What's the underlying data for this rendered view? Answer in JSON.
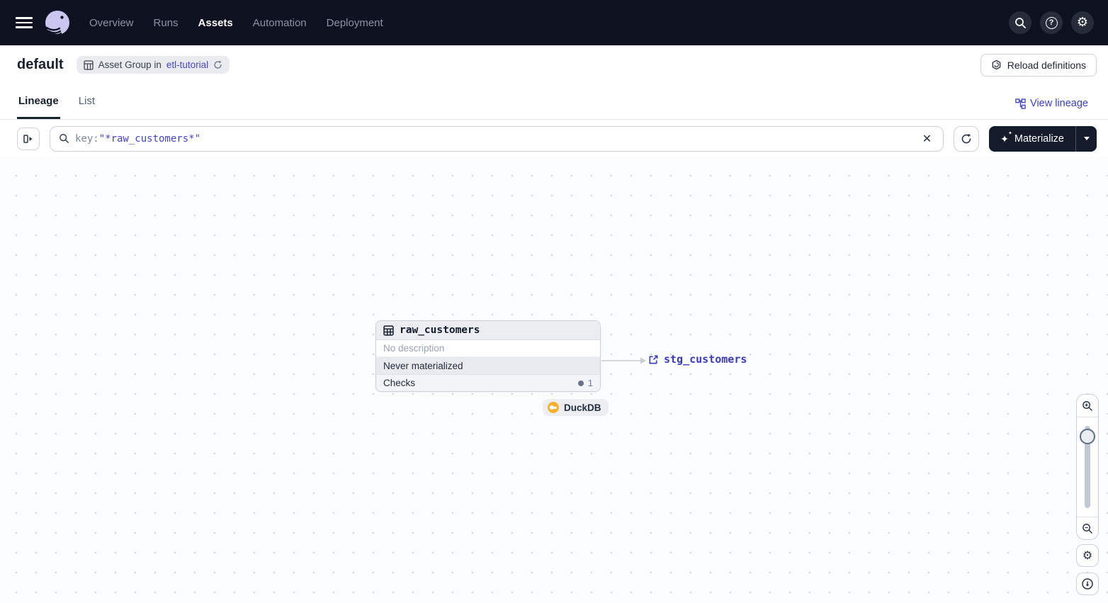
{
  "topnav": {
    "items": [
      {
        "label": "Overview",
        "active": false
      },
      {
        "label": "Runs",
        "active": false
      },
      {
        "label": "Assets",
        "active": true
      },
      {
        "label": "Automation",
        "active": false
      },
      {
        "label": "Deployment",
        "active": false
      }
    ]
  },
  "header": {
    "title": "default",
    "badge_text": "Asset Group in",
    "badge_link": "etl-tutorial",
    "reload_label": "Reload definitions"
  },
  "tabs": {
    "lineage": "Lineage",
    "list": "List",
    "view_lineage": "View lineage"
  },
  "toolbar": {
    "search_key": "key:",
    "search_value": "\"*raw_customers*\"",
    "materialize_label": "Materialize"
  },
  "graph": {
    "node": {
      "title": "raw_customers",
      "description": "No description",
      "status": "Never materialized",
      "checks_label": "Checks",
      "checks_count": "1",
      "kind": "DuckDB"
    },
    "downstream": {
      "label": "stg_customers"
    }
  },
  "colors": {
    "topnav_bg": "#0e1220",
    "accent_link": "#4343c8",
    "materialize_bg": "#141b2b",
    "duckdb_yellow": "#f5b02e",
    "edge": "#c8cdd5"
  }
}
